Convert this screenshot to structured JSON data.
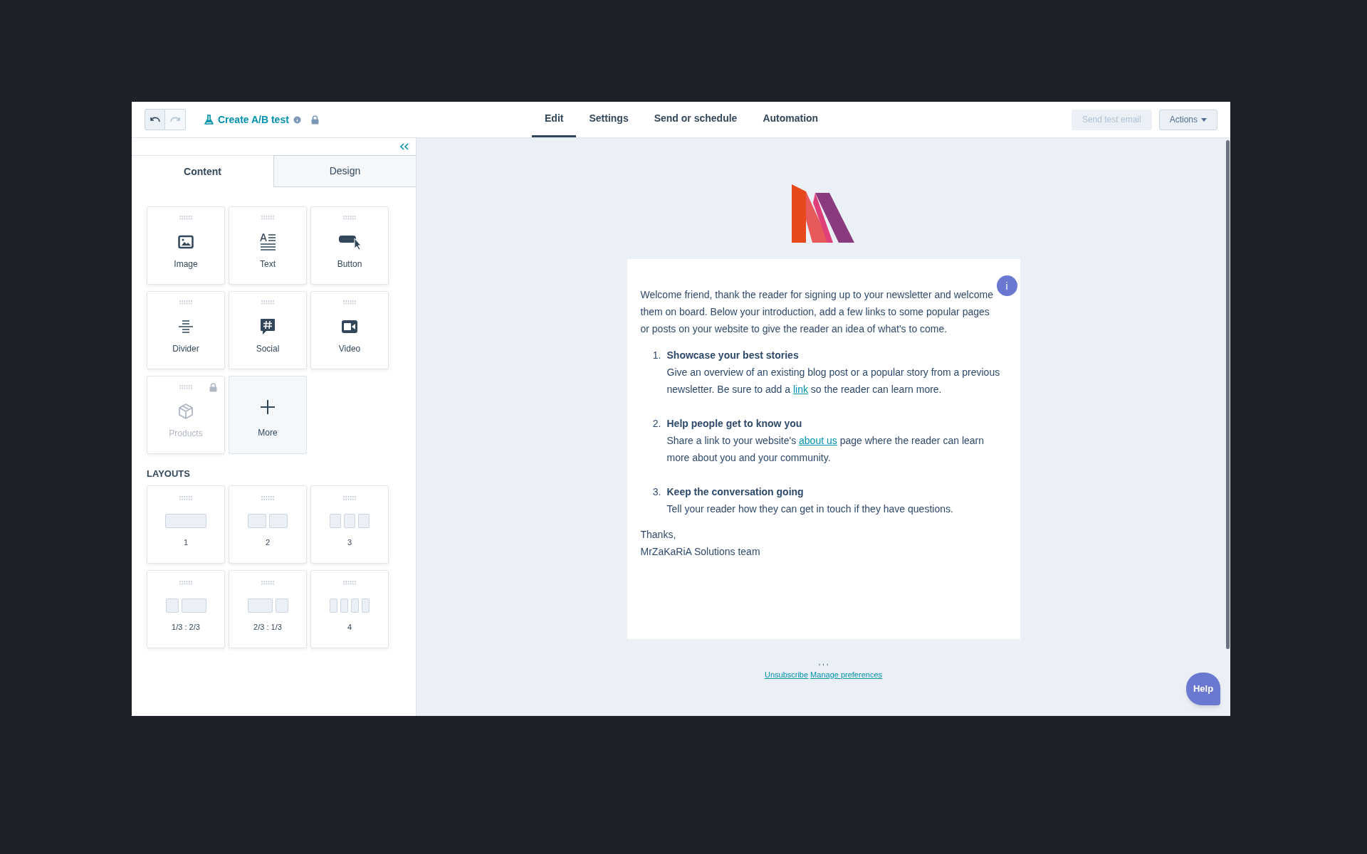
{
  "toolbar": {
    "undo_disabled": false,
    "redo_disabled": true,
    "ab_test": "Create A/B test",
    "locked": true
  },
  "tabs": [
    {
      "label": "Edit",
      "selected": true
    },
    {
      "label": "Settings",
      "selected": false
    },
    {
      "label": "Send or schedule",
      "selected": false
    },
    {
      "label": "Automation",
      "selected": false
    }
  ],
  "actions": [
    {
      "label": "Send test email",
      "kind": "plain",
      "disabled": true
    },
    {
      "label": "Actions",
      "kind": "menu",
      "disabled": false
    }
  ],
  "panel_tabs": [
    {
      "label": "Content",
      "selected": true
    },
    {
      "label": "Design",
      "selected": false
    }
  ],
  "modules": [
    {
      "label": "Image",
      "kind": "image",
      "locked": false
    },
    {
      "label": "Text",
      "kind": "text",
      "locked": false
    },
    {
      "label": "Button",
      "kind": "button",
      "locked": false
    },
    {
      "label": "Divider",
      "kind": "divider",
      "locked": false
    },
    {
      "label": "Social",
      "kind": "social",
      "locked": false
    },
    {
      "label": "Video",
      "kind": "video",
      "locked": false
    },
    {
      "label": "Products",
      "kind": "products",
      "locked": true
    },
    {
      "label": "More",
      "kind": "more",
      "locked": false
    }
  ],
  "layouts_heading": "LAYOUTS",
  "layouts": [
    {
      "label": "1",
      "kind": "one"
    },
    {
      "label": "2",
      "kind": "two"
    },
    {
      "label": "3",
      "kind": "three"
    },
    {
      "label": "1/3 : 2/3",
      "kind": "narrowwide"
    },
    {
      "label": "2/3 : 1/3",
      "kind": "widenarrow"
    },
    {
      "label": "4",
      "kind": "four"
    }
  ],
  "email": {
    "intro": "Welcome friend, thank the reader for signing up to your newsletter and welcome them on board. Below your introduction, add a few links to some popular pages or posts on your website to give the reader an idea of what's to come.",
    "items": [
      {
        "number": "1.",
        "title": "Showcase your best stories",
        "before": "Give an overview of an existing blog post or a popular story from a previous newsletter. Be sure to add a",
        "link": "link",
        "after": "so the reader can learn more."
      },
      {
        "number": "2.",
        "title": "Help people get to know you",
        "before": "Share a link to your website's",
        "link": "about us",
        "after": "page where the reader can learn more about you and your community."
      },
      {
        "number": "3.",
        "title": "Keep the conversation going",
        "before": "Tell your reader how they can get in touch if they have questions."
      }
    ],
    "closing": "Thanks,",
    "signature": "MrZaKaRiA Solutions team",
    "info_badge": "i"
  },
  "footer": {
    "address": ", , ,",
    "links": [
      "Unsubscribe",
      "Manage preferences"
    ]
  },
  "help": "Help"
}
